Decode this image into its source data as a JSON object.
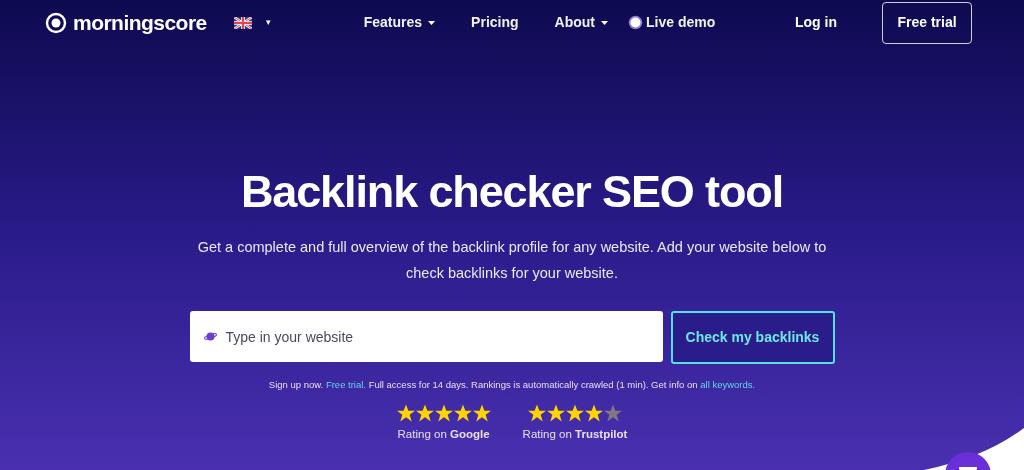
{
  "nav": {
    "logo": "morningscore",
    "language_caret": "▾",
    "items": [
      {
        "label": "Features",
        "dropdown": true
      },
      {
        "label": "Pricing",
        "dropdown": false
      },
      {
        "label": "About",
        "dropdown": true
      },
      {
        "label": "Live demo",
        "dropdown": false,
        "kind": "demo"
      }
    ],
    "login": "Log in",
    "cta": "Free trial"
  },
  "hero": {
    "title": "Backlink checker SEO tool",
    "subtitle": "Get a complete and full overview of the backlink profile for any website. Add your website below to check backlinks for your website.",
    "search": {
      "placeholder": "Type in your website"
    },
    "button": "Check my backlinks",
    "note": [
      {
        "kind": "text",
        "text": "Sign up now. "
      },
      {
        "kind": "link",
        "text": "Free trial."
      },
      {
        "kind": "text",
        "text": " Full access for 14 days. Rankings is automatically crawled (1 min). Get info on "
      },
      {
        "kind": "link",
        "text": "all keywords."
      }
    ],
    "ratings": [
      {
        "stars": 5,
        "label": "Rating on **Google**"
      },
      {
        "stars": 4,
        "label": "Rating on **Trustpilot**"
      }
    ]
  }
}
